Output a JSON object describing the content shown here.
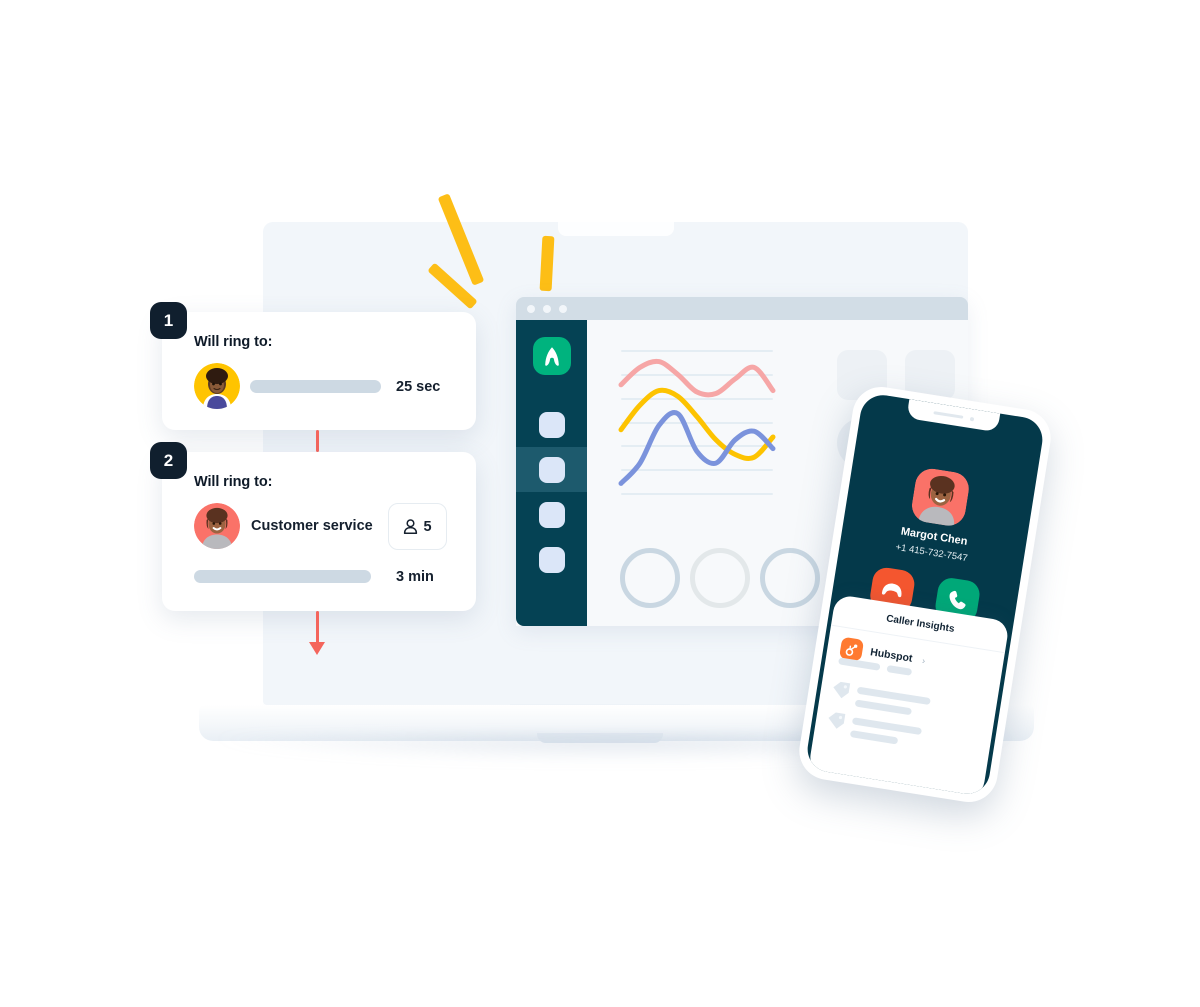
{
  "scene": {
    "title": "Aircall call routing product illustration",
    "colors": {
      "brand_teal": "#054254",
      "brand_green": "#00b37e",
      "accent_yellow": "#FDBE16",
      "accent_red": "#f4562f",
      "connector_red": "#f4655c",
      "phone_screen": "#04394a",
      "badge_dark": "#101f2e",
      "skeleton": "#cdd9e3",
      "hubspot_orange": "#ff7a30"
    }
  },
  "flow": {
    "steps": [
      {
        "badge": "1",
        "label": "Will ring to:",
        "avatar_name": "agent-avatar-yellow",
        "target_name": "",
        "duration": "25 sec",
        "member_count": ""
      },
      {
        "badge": "2",
        "label": "Will ring to:",
        "avatar_name": "team-avatar-coral",
        "target_name": "Customer service",
        "duration": "3 min",
        "member_count": "5"
      }
    ]
  },
  "dashboard": {
    "window_dots": [
      "dot",
      "dot",
      "dot"
    ],
    "sidebar": {
      "logo_name": "aircall-logo",
      "items": [
        {
          "name": "sidebar-item-1",
          "active": false
        },
        {
          "name": "sidebar-item-2",
          "active": true
        },
        {
          "name": "sidebar-item-3",
          "active": false
        },
        {
          "name": "sidebar-item-4",
          "active": false
        }
      ]
    },
    "rings": [
      "ring-metric-1",
      "ring-metric-2",
      "ring-metric-3"
    ],
    "tiles_count": 9,
    "chart_data": {
      "type": "line",
      "title": "",
      "xlabel": "",
      "ylabel": "",
      "grid": true,
      "gridlines": 7,
      "legend": "none",
      "x": [
        0,
        1,
        2,
        3,
        4,
        5,
        6,
        7,
        8
      ],
      "ylim": [
        0,
        100
      ],
      "series": [
        {
          "name": "pink-series",
          "color": "#f6a6a6",
          "values": [
            76,
            88,
            92,
            83,
            71,
            70,
            80,
            88,
            72
          ]
        },
        {
          "name": "yellow-series",
          "color": "#fdc300",
          "values": [
            45,
            62,
            72,
            68,
            54,
            38,
            28,
            26,
            40
          ]
        },
        {
          "name": "blue-series",
          "color": "#7b93dc",
          "values": [
            8,
            22,
            48,
            56,
            30,
            22,
            38,
            44,
            32
          ]
        }
      ]
    }
  },
  "phone": {
    "notch": {
      "speaker": "speaker-slit",
      "camera": "front-camera"
    },
    "caller": {
      "avatar_name": "caller-avatar",
      "name": "Margot Chen",
      "phone_number": "+1 415-732-7547"
    },
    "actions": [
      {
        "name": "decline-call-button",
        "icon": "phone-hangup-icon",
        "color": "#f4562f"
      },
      {
        "name": "accept-call-button",
        "icon": "phone-icon",
        "color": "#00a878"
      }
    ],
    "insights": {
      "title": "Caller Insights",
      "crm": {
        "icon": "hubspot-icon",
        "name": "Hubspot",
        "chevron": "›"
      },
      "skeleton_rows": 5,
      "tag_icons": 2
    }
  }
}
